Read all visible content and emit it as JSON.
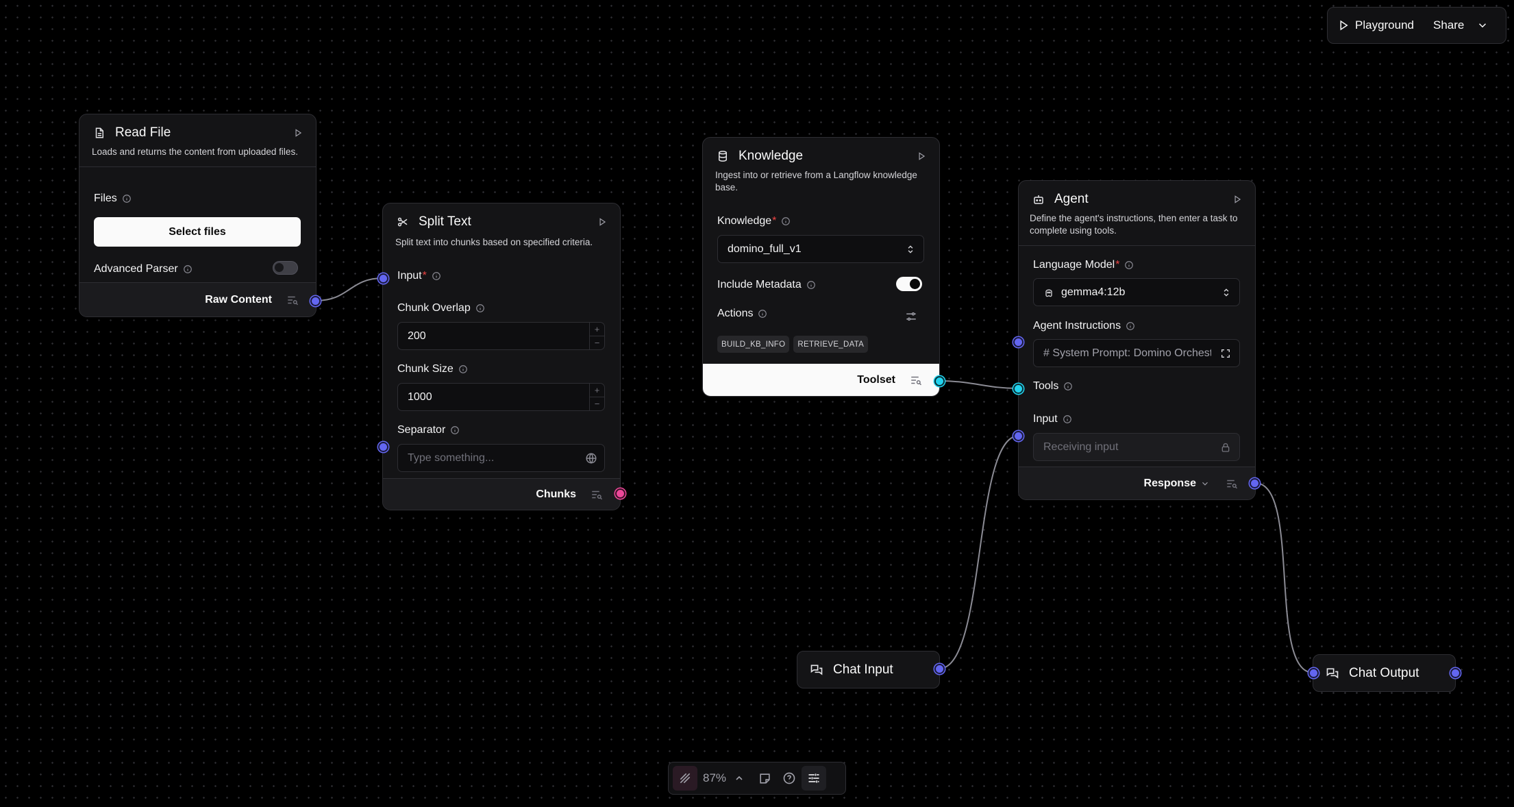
{
  "topbar": {
    "playground_label": "Playground",
    "share_label": "Share"
  },
  "read_file": {
    "title": "Read File",
    "description": "Loads and returns the content from uploaded files.",
    "files_label": "Files",
    "select_files_label": "Select files",
    "advanced_parser_label": "Advanced Parser",
    "advanced_parser_on": false,
    "output_label": "Raw Content"
  },
  "split_text": {
    "title": "Split Text",
    "description": "Split text into chunks based on specified criteria.",
    "input_label": "Input",
    "chunk_overlap_label": "Chunk Overlap",
    "chunk_overlap_value": "200",
    "chunk_size_label": "Chunk Size",
    "chunk_size_value": "1000",
    "separator_label": "Separator",
    "separator_placeholder": "Type something...",
    "output_label": "Chunks"
  },
  "knowledge": {
    "title": "Knowledge",
    "description": "Ingest into or retrieve from a Langflow knowledge base.",
    "knowledge_label": "Knowledge",
    "knowledge_value": "domino_full_v1",
    "include_metadata_label": "Include Metadata",
    "include_metadata_on": true,
    "actions_label": "Actions",
    "actions": [
      "BUILD_KB_INFO",
      "RETRIEVE_DATA"
    ],
    "output_label": "Toolset"
  },
  "agent": {
    "title": "Agent",
    "description": "Define the agent's instructions, then enter a task to complete using tools.",
    "language_model_label": "Language Model",
    "language_model_value": "gemma4:12b",
    "agent_instructions_label": "Agent Instructions",
    "agent_instructions_value": "# System Prompt: Domino Orchestra",
    "tools_label": "Tools",
    "input_label": "Input",
    "input_placeholder": "Receiving input",
    "output_label": "Response"
  },
  "chat_input": {
    "title": "Chat Input"
  },
  "chat_output": {
    "title": "Chat Output"
  },
  "bottombar": {
    "zoom": "87%"
  },
  "colors": {
    "handle_indigo": "#6366f1",
    "handle_cyan": "#22d3ee",
    "handle_pink": "#ec4899",
    "edge": "#8b8b94"
  }
}
